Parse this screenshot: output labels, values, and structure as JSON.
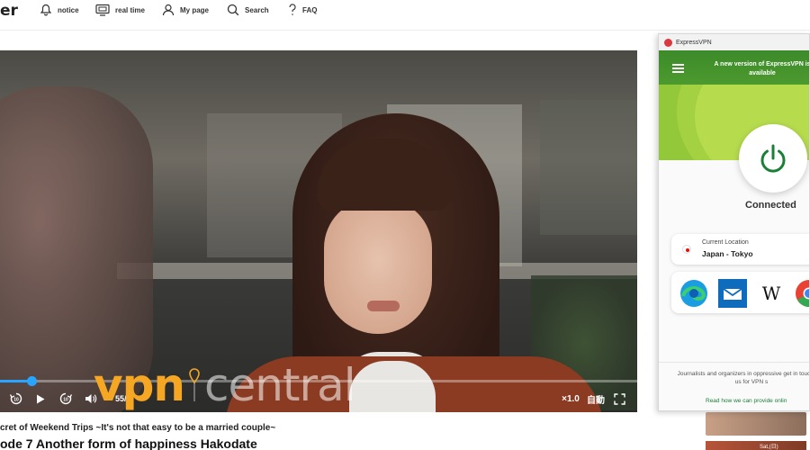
{
  "site": {
    "logo_fragment": "er",
    "nav": [
      {
        "label": "notice",
        "icon": "bell-icon"
      },
      {
        "label": "real time",
        "icon": "tv-icon"
      },
      {
        "label": "My page",
        "icon": "user-icon"
      },
      {
        "label": "Search",
        "icon": "search-icon"
      },
      {
        "label": "FAQ",
        "icon": "question-icon"
      }
    ]
  },
  "player": {
    "time": "55/",
    "speed": "×1.0",
    "quality": "自動",
    "progress": 0.05,
    "colors": {
      "accent": "#2aa5ff"
    }
  },
  "watermark": {
    "part1": "vpn",
    "part2": "central"
  },
  "episode": {
    "subtitle": "cret of Weekend Trips ~It's not that easy to be a married couple~",
    "title": "ode 7 Another form of happiness Hakodate"
  },
  "thumbnails": {
    "caption": "Sat,(日)"
  },
  "vpn": {
    "app_name": "ExpressVPN",
    "notice": "A new version of ExpressVPN is available",
    "status": "Connected",
    "location_label": "Current Location",
    "location_value": "Japan - Tokyo",
    "shortcut_wiki": "W",
    "footer": "Journalists and organizers in oppressive get in touch with us for VPN s",
    "link": "Read how we can provide onlin",
    "colors": {
      "green": "#3c8a2a",
      "power": "#1a7f37"
    }
  }
}
